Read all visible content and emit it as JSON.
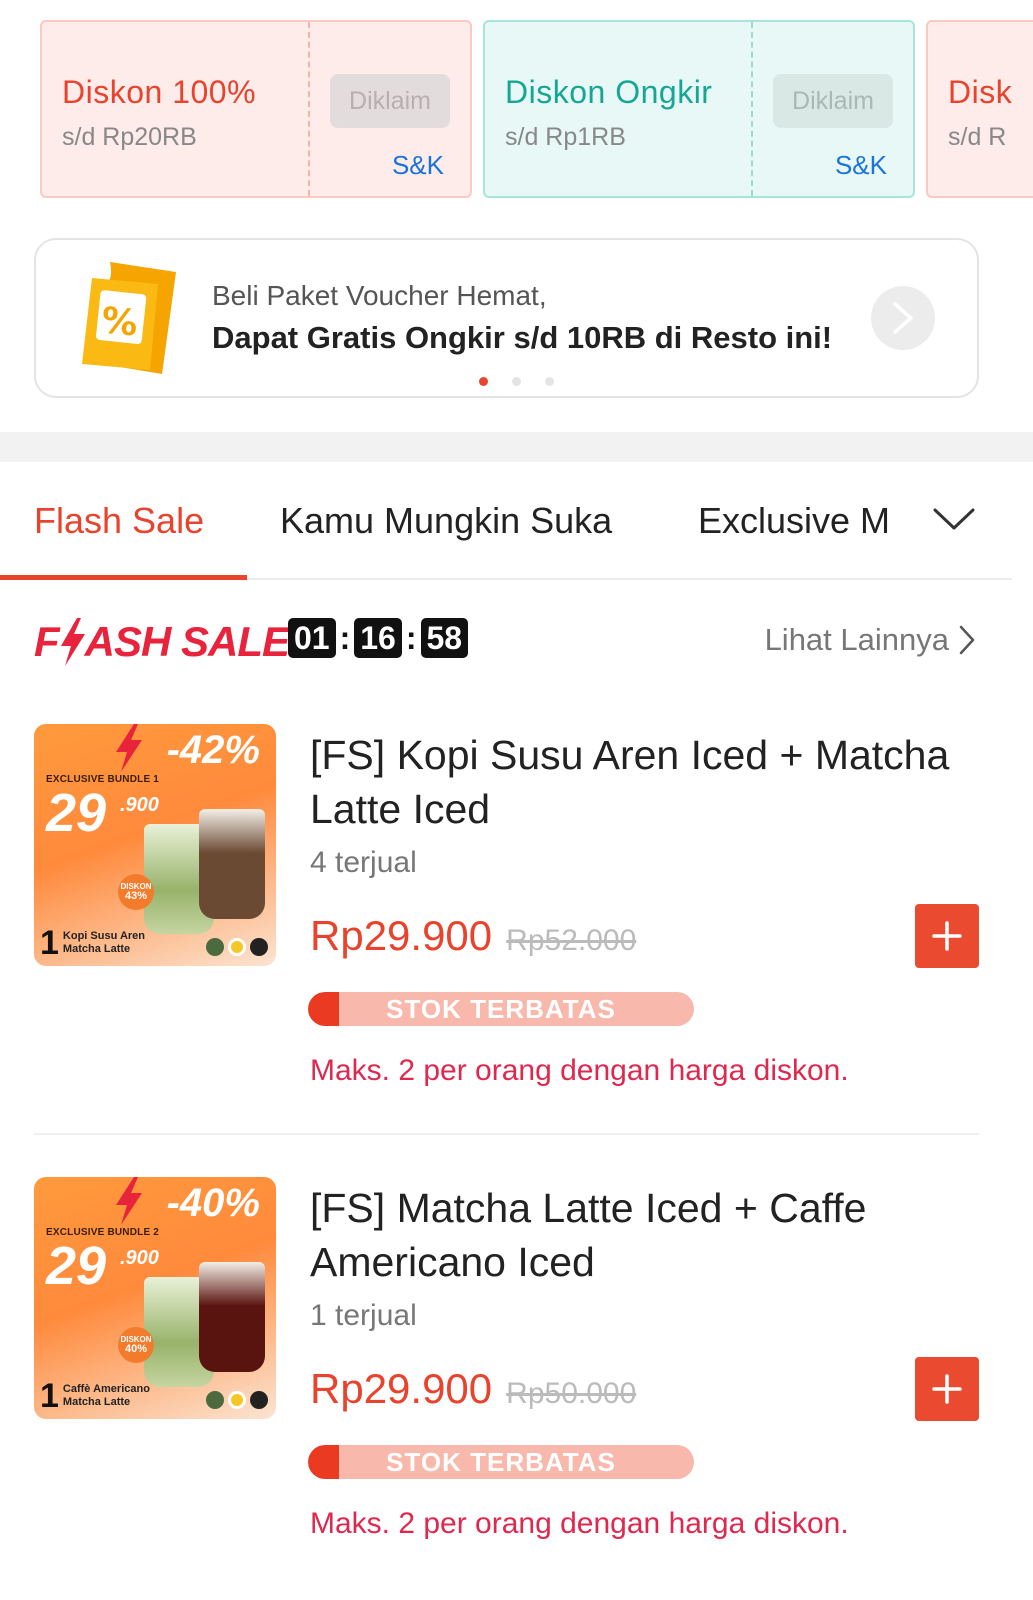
{
  "vouchers": [
    {
      "title": "Diskon 100%",
      "subtitle": "s/d Rp20RB",
      "button": "Diklaim",
      "terms": "S&K",
      "theme": "red"
    },
    {
      "title": "Diskon Ongkir",
      "subtitle": "s/d Rp1RB",
      "button": "Diklaim",
      "terms": "S&K",
      "theme": "teal"
    },
    {
      "title": "Disk",
      "subtitle": "s/d R",
      "theme": "red"
    }
  ],
  "banner": {
    "line1": "Beli Paket Voucher Hemat,",
    "line2": "Dapat Gratis Ongkir s/d 10RB di Resto ini!",
    "icon": "voucher-percent-icon",
    "active_dot": 0,
    "dot_count": 3
  },
  "tabs": {
    "items": [
      "Flash Sale",
      "Kamu Mungkin Suka",
      "Exclusive M"
    ],
    "active": 0
  },
  "flash_sale": {
    "logo": "FLASH SALE",
    "timer": {
      "hours": "01",
      "minutes": "16",
      "seconds": "58"
    },
    "see_more": "Lihat Lainnya"
  },
  "products": [
    {
      "name": "[FS] Kopi Susu Aren Iced + Matcha Latte Iced",
      "sold": "4 terjual",
      "price": "Rp29.900",
      "old_price": "Rp52.000",
      "stock_label": "STOK TERBATAS",
      "stock_fill": 0.08,
      "limit": "Maks. 2 per orang dengan harga diskon.",
      "thumb": {
        "discount": "-42%",
        "bundle": "EXCLUSIVE BUNDLE 1",
        "big": "29",
        "small": ".900",
        "badge_top": "DISKON",
        "badge_val": "43%",
        "foot_num": "1",
        "foot_line1": "Kopi Susu Aren",
        "foot_line2": "Matcha Latte",
        "cup2_color": "#6b4a34"
      }
    },
    {
      "name": "[FS] Matcha Latte Iced + Caffe Americano Iced",
      "sold": "1 terjual",
      "price": "Rp29.900",
      "old_price": "Rp50.000",
      "stock_label": "STOK TERBATAS",
      "stock_fill": 0.08,
      "limit": "Maks. 2 per orang dengan harga diskon.",
      "thumb": {
        "discount": "-40%",
        "bundle": "EXCLUSIVE BUNDLE 2",
        "big": "29",
        "small": ".900",
        "badge_top": "DISKON",
        "badge_val": "40%",
        "foot_num": "1",
        "foot_line1": "Caffè Americano",
        "foot_line2": "Matcha Latte",
        "cup2_color": "#5a1410"
      }
    }
  ],
  "colors": {
    "accent": "#e8432c",
    "teal": "#17a694",
    "link": "#1a73d9",
    "limit_text": "#e0284f"
  }
}
